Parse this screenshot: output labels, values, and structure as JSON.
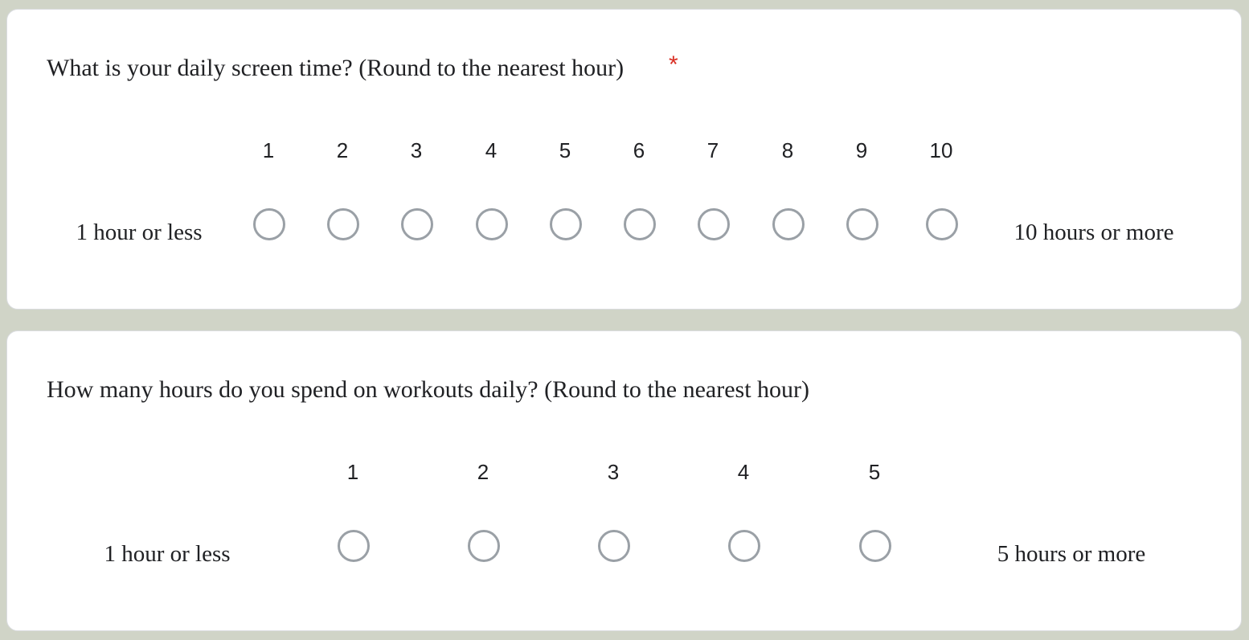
{
  "questions": [
    {
      "title": "What is your daily screen time? (Round to the nearest hour)",
      "required_marker": "*",
      "scale": [
        "1",
        "2",
        "3",
        "4",
        "5",
        "6",
        "7",
        "8",
        "9",
        "10"
      ],
      "low_label": "1 hour or less",
      "high_label": "10 hours or more",
      "selected": null
    },
    {
      "title": "How many hours do you spend on workouts daily?  (Round to the nearest hour)",
      "scale": [
        "1",
        "2",
        "3",
        "4",
        "5"
      ],
      "low_label": "1 hour or less",
      "high_label": "5 hours or more",
      "selected": null
    }
  ],
  "colors": {
    "page_background": "#d0d4c7",
    "card_background": "#ffffff",
    "radio_border": "#9aa0a6",
    "required_star": "#d93025",
    "text": "#202124"
  }
}
